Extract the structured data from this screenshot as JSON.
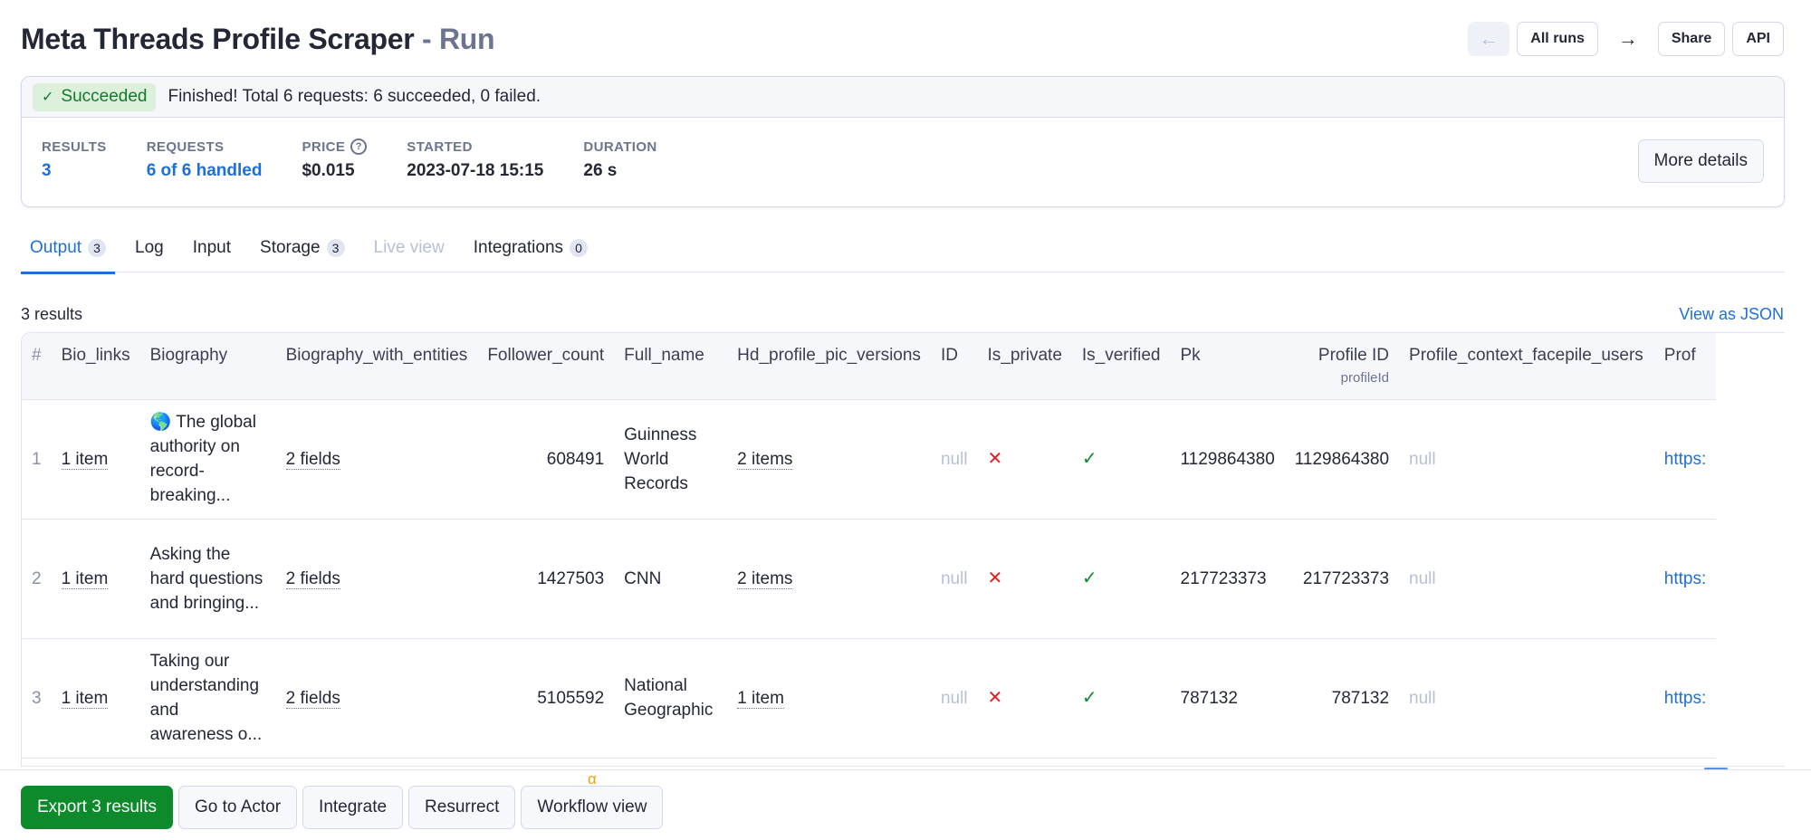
{
  "header": {
    "title": "Meta Threads Profile Scraper",
    "title_suffix": " - Run",
    "actions": {
      "back_icon": "arrow-left-icon",
      "all_runs": "All runs",
      "forward_icon": "arrow-right-icon",
      "share": "Share",
      "api": "API"
    }
  },
  "status": {
    "badge": "Succeeded",
    "badge_icon": "check-icon",
    "message": "Finished! Total 6 requests: 6 succeeded, 0 failed.",
    "stats": [
      {
        "label": "RESULTS",
        "value": "3"
      },
      {
        "label": "REQUESTS",
        "value": "6 of 6 handled"
      },
      {
        "label": "PRICE",
        "value": "$0.015"
      },
      {
        "label": "STARTED",
        "value": "2023-07-18 15:15"
      },
      {
        "label": "DURATION",
        "value": "26 s"
      }
    ],
    "more_details": "More details"
  },
  "tabs": [
    {
      "label": "Output",
      "count": "3"
    },
    {
      "label": "Log"
    },
    {
      "label": "Input"
    },
    {
      "label": "Storage",
      "count": "3"
    },
    {
      "label": "Live view"
    },
    {
      "label": "Integrations",
      "count": "0"
    }
  ],
  "results": {
    "count_label": "3 results",
    "view_json": "View as JSON"
  },
  "table": {
    "columns": [
      "#",
      "Bio_links",
      "Biography",
      "Biography_with_entities",
      "Follower_count",
      "Full_name",
      "Hd_profile_pic_versions",
      "ID",
      "Is_private",
      "Is_verified",
      "Pk",
      "Profile ID",
      "Profile_context_facepile_users",
      "Prof"
    ],
    "profile_id_sub": "profileId",
    "rows": [
      {
        "num": "1",
        "bio_links": "1 item",
        "biography": "🌎 The global authority on record-breaking...",
        "bio_entities": "2 fields",
        "follower_count": "608491",
        "full_name": "Guinness World Records",
        "hd_pics": "2 items",
        "id": "null",
        "is_private": "✕",
        "is_verified": "✓",
        "pk": "1129864380",
        "profile_id": "1129864380",
        "facepile": "null",
        "prof": "https:"
      },
      {
        "num": "2",
        "bio_links": "1 item",
        "biography": "Asking the hard questions and bringing...",
        "bio_entities": "2 fields",
        "follower_count": "1427503",
        "full_name": "CNN",
        "hd_pics": "2 items",
        "id": "null",
        "is_private": "✕",
        "is_verified": "✓",
        "pk": "217723373",
        "profile_id": "217723373",
        "facepile": "null",
        "prof": "https:"
      },
      {
        "num": "3",
        "bio_links": "1 item",
        "biography": "Taking our understanding and awareness o...",
        "bio_entities": "2 fields",
        "follower_count": "5105592",
        "full_name": "National Geographic",
        "hd_pics": "1 item",
        "id": "null",
        "is_private": "✕",
        "is_verified": "✓",
        "pk": "787132",
        "profile_id": "787132",
        "facepile": "null",
        "prof": "https:"
      }
    ]
  },
  "bottom_bar": {
    "export": "Export 3 results",
    "go_to_actor": "Go to Actor",
    "integrate": "Integrate",
    "resurrect": "Resurrect",
    "workflow_view": "Workflow view",
    "workflow_badge": "α"
  },
  "colors": {
    "accent": "#1f6fd8",
    "success": "#0c8a2c",
    "error": "#e02020"
  }
}
